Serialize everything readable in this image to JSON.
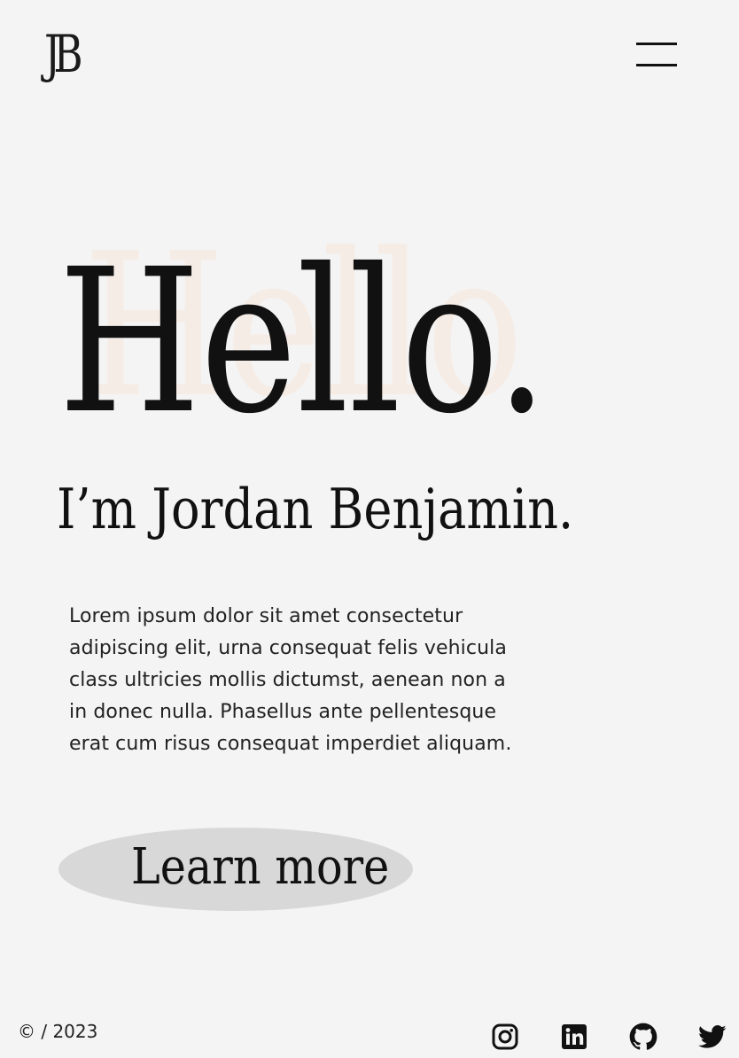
{
  "header": {
    "logo": "JB"
  },
  "hero": {
    "hello_ghost": "Hello",
    "hello": "Hello.",
    "name": "I’m Jordan Benjamin.",
    "intro": "Lorem ipsum dolor sit amet consectetur adipiscing elit, urna consequat felis vehicula class ultricies mollis dictumst, aenean non a in donec nulla. Phasellus ante pellentesque erat cum risus consequat imperdiet aliquam.",
    "cta_label": "Learn more"
  },
  "footer": {
    "copyright": "© / 2023",
    "social": [
      "instagram-icon",
      "linkedin-icon",
      "github-icon",
      "twitter-icon"
    ]
  },
  "colors": {
    "background": "#f4f4f4",
    "text": "#111111",
    "ghost_text": "#f6ece6",
    "button": "#d8d8d8"
  }
}
